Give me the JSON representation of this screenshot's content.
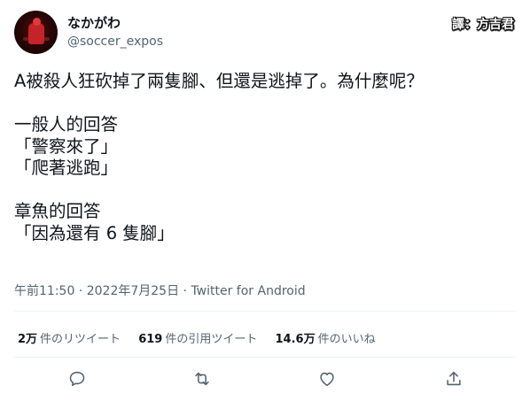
{
  "author": {
    "display_name": "なかがわ",
    "handle": "@soccer_expos"
  },
  "translator_stamp": "譯：方吉君",
  "tweet": {
    "lines": [
      "A被殺人狂砍掉了兩隻腳、但還是逃掉了。為什麼呢？",
      "",
      "一般人的回答",
      "「警察來了」",
      "「爬著逃跑」",
      "",
      "章魚的回答",
      "「因為還有 6 隻腳」"
    ]
  },
  "meta": {
    "time": "午前11:50",
    "separator1": " · ",
    "date": "2022年7月25日",
    "separator2": " · ",
    "source": "Twitter for Android"
  },
  "stats": {
    "retweets_count": "2万",
    "retweets_label": "件のリツイート",
    "quotes_count": "619",
    "quotes_label": "件の引用ツイート",
    "likes_count": "14.6万",
    "likes_label": "件のいいね"
  },
  "icons": {
    "reply": "reply-icon",
    "retweet": "retweet-icon",
    "like": "heart-icon",
    "share": "share-icon"
  },
  "colors": {
    "text": "#0f1419",
    "secondary": "#536471",
    "divider": "#eff3f4"
  }
}
